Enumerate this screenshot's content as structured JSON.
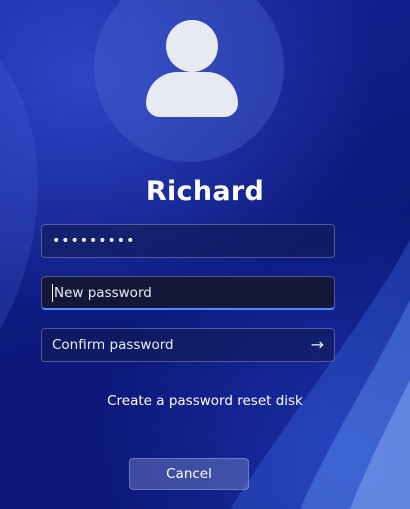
{
  "user": {
    "name": "Richard"
  },
  "fields": {
    "current_password_value": "•••••••••",
    "new_password_placeholder": "New password",
    "confirm_password_placeholder": "Confirm password"
  },
  "links": {
    "reset_disk": "Create a password reset disk"
  },
  "buttons": {
    "cancel": "Cancel",
    "submit_icon": "arrow-right-icon"
  },
  "colors": {
    "accent": "#4f8bff",
    "background": "#0d1b8a"
  }
}
